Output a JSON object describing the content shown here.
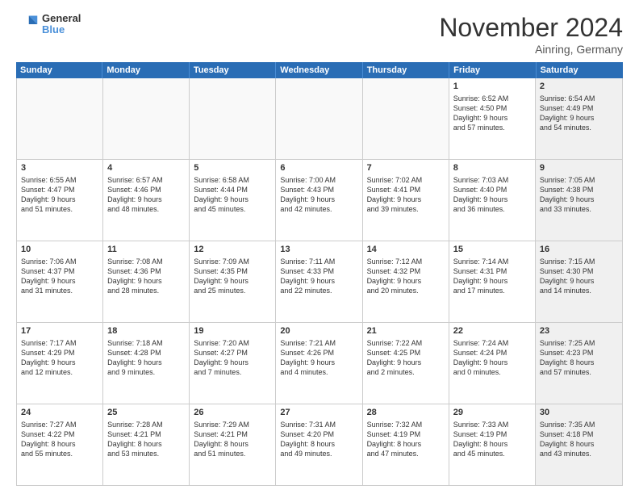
{
  "logo": {
    "general": "General",
    "blue": "Blue"
  },
  "header": {
    "month": "November 2024",
    "location": "Ainring, Germany"
  },
  "weekdays": [
    "Sunday",
    "Monday",
    "Tuesday",
    "Wednesday",
    "Thursday",
    "Friday",
    "Saturday"
  ],
  "rows": [
    [
      {
        "day": "",
        "empty": true
      },
      {
        "day": "",
        "empty": true
      },
      {
        "day": "",
        "empty": true
      },
      {
        "day": "",
        "empty": true
      },
      {
        "day": "",
        "empty": true
      },
      {
        "day": "1",
        "lines": [
          "Sunrise: 6:52 AM",
          "Sunset: 4:50 PM",
          "Daylight: 9 hours",
          "and 57 minutes."
        ]
      },
      {
        "day": "2",
        "lines": [
          "Sunrise: 6:54 AM",
          "Sunset: 4:49 PM",
          "Daylight: 9 hours",
          "and 54 minutes."
        ],
        "shaded": true
      }
    ],
    [
      {
        "day": "3",
        "lines": [
          "Sunrise: 6:55 AM",
          "Sunset: 4:47 PM",
          "Daylight: 9 hours",
          "and 51 minutes."
        ]
      },
      {
        "day": "4",
        "lines": [
          "Sunrise: 6:57 AM",
          "Sunset: 4:46 PM",
          "Daylight: 9 hours",
          "and 48 minutes."
        ]
      },
      {
        "day": "5",
        "lines": [
          "Sunrise: 6:58 AM",
          "Sunset: 4:44 PM",
          "Daylight: 9 hours",
          "and 45 minutes."
        ]
      },
      {
        "day": "6",
        "lines": [
          "Sunrise: 7:00 AM",
          "Sunset: 4:43 PM",
          "Daylight: 9 hours",
          "and 42 minutes."
        ]
      },
      {
        "day": "7",
        "lines": [
          "Sunrise: 7:02 AM",
          "Sunset: 4:41 PM",
          "Daylight: 9 hours",
          "and 39 minutes."
        ]
      },
      {
        "day": "8",
        "lines": [
          "Sunrise: 7:03 AM",
          "Sunset: 4:40 PM",
          "Daylight: 9 hours",
          "and 36 minutes."
        ]
      },
      {
        "day": "9",
        "lines": [
          "Sunrise: 7:05 AM",
          "Sunset: 4:38 PM",
          "Daylight: 9 hours",
          "and 33 minutes."
        ],
        "shaded": true
      }
    ],
    [
      {
        "day": "10",
        "lines": [
          "Sunrise: 7:06 AM",
          "Sunset: 4:37 PM",
          "Daylight: 9 hours",
          "and 31 minutes."
        ]
      },
      {
        "day": "11",
        "lines": [
          "Sunrise: 7:08 AM",
          "Sunset: 4:36 PM",
          "Daylight: 9 hours",
          "and 28 minutes."
        ]
      },
      {
        "day": "12",
        "lines": [
          "Sunrise: 7:09 AM",
          "Sunset: 4:35 PM",
          "Daylight: 9 hours",
          "and 25 minutes."
        ]
      },
      {
        "day": "13",
        "lines": [
          "Sunrise: 7:11 AM",
          "Sunset: 4:33 PM",
          "Daylight: 9 hours",
          "and 22 minutes."
        ]
      },
      {
        "day": "14",
        "lines": [
          "Sunrise: 7:12 AM",
          "Sunset: 4:32 PM",
          "Daylight: 9 hours",
          "and 20 minutes."
        ]
      },
      {
        "day": "15",
        "lines": [
          "Sunrise: 7:14 AM",
          "Sunset: 4:31 PM",
          "Daylight: 9 hours",
          "and 17 minutes."
        ]
      },
      {
        "day": "16",
        "lines": [
          "Sunrise: 7:15 AM",
          "Sunset: 4:30 PM",
          "Daylight: 9 hours",
          "and 14 minutes."
        ],
        "shaded": true
      }
    ],
    [
      {
        "day": "17",
        "lines": [
          "Sunrise: 7:17 AM",
          "Sunset: 4:29 PM",
          "Daylight: 9 hours",
          "and 12 minutes."
        ]
      },
      {
        "day": "18",
        "lines": [
          "Sunrise: 7:18 AM",
          "Sunset: 4:28 PM",
          "Daylight: 9 hours",
          "and 9 minutes."
        ]
      },
      {
        "day": "19",
        "lines": [
          "Sunrise: 7:20 AM",
          "Sunset: 4:27 PM",
          "Daylight: 9 hours",
          "and 7 minutes."
        ]
      },
      {
        "day": "20",
        "lines": [
          "Sunrise: 7:21 AM",
          "Sunset: 4:26 PM",
          "Daylight: 9 hours",
          "and 4 minutes."
        ]
      },
      {
        "day": "21",
        "lines": [
          "Sunrise: 7:22 AM",
          "Sunset: 4:25 PM",
          "Daylight: 9 hours",
          "and 2 minutes."
        ]
      },
      {
        "day": "22",
        "lines": [
          "Sunrise: 7:24 AM",
          "Sunset: 4:24 PM",
          "Daylight: 9 hours",
          "and 0 minutes."
        ]
      },
      {
        "day": "23",
        "lines": [
          "Sunrise: 7:25 AM",
          "Sunset: 4:23 PM",
          "Daylight: 8 hours",
          "and 57 minutes."
        ],
        "shaded": true
      }
    ],
    [
      {
        "day": "24",
        "lines": [
          "Sunrise: 7:27 AM",
          "Sunset: 4:22 PM",
          "Daylight: 8 hours",
          "and 55 minutes."
        ]
      },
      {
        "day": "25",
        "lines": [
          "Sunrise: 7:28 AM",
          "Sunset: 4:21 PM",
          "Daylight: 8 hours",
          "and 53 minutes."
        ]
      },
      {
        "day": "26",
        "lines": [
          "Sunrise: 7:29 AM",
          "Sunset: 4:21 PM",
          "Daylight: 8 hours",
          "and 51 minutes."
        ]
      },
      {
        "day": "27",
        "lines": [
          "Sunrise: 7:31 AM",
          "Sunset: 4:20 PM",
          "Daylight: 8 hours",
          "and 49 minutes."
        ]
      },
      {
        "day": "28",
        "lines": [
          "Sunrise: 7:32 AM",
          "Sunset: 4:19 PM",
          "Daylight: 8 hours",
          "and 47 minutes."
        ]
      },
      {
        "day": "29",
        "lines": [
          "Sunrise: 7:33 AM",
          "Sunset: 4:19 PM",
          "Daylight: 8 hours",
          "and 45 minutes."
        ]
      },
      {
        "day": "30",
        "lines": [
          "Sunrise: 7:35 AM",
          "Sunset: 4:18 PM",
          "Daylight: 8 hours",
          "and 43 minutes."
        ],
        "shaded": true
      }
    ]
  ]
}
